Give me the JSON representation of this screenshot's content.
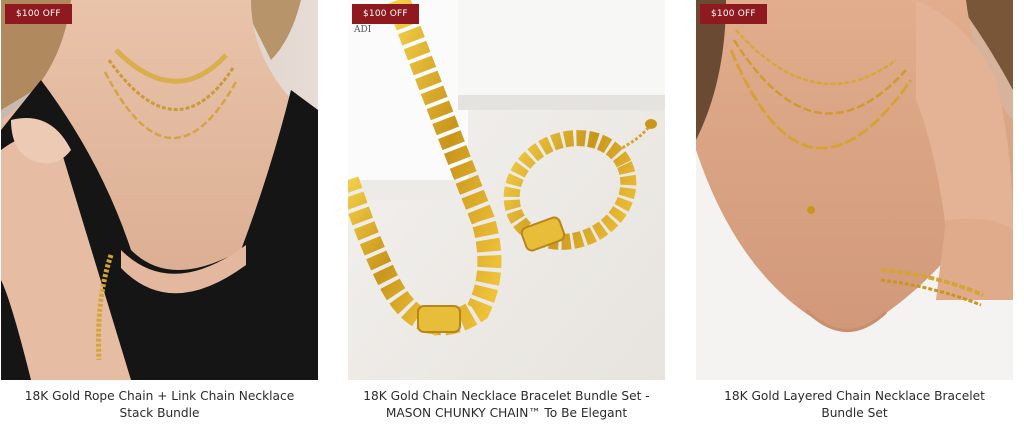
{
  "products": [
    {
      "badge": "$100 OFF",
      "title": "18K Gold Rope Chain + Link Chain Necklace Stack Bundle"
    },
    {
      "badge": "$100 OFF",
      "title": "18K Gold Chain Necklace Bracelet Bundle Set - MASON CHUNKY CHAIN™ To Be Elegant"
    },
    {
      "badge": "$100 OFF",
      "title": "18K Gold Layered Chain Necklace Bracelet Bundle Set"
    }
  ],
  "colors": {
    "badge_bg": "#8e1a1f",
    "gold": "#d4a437",
    "title_text": "#2b2b2b"
  }
}
